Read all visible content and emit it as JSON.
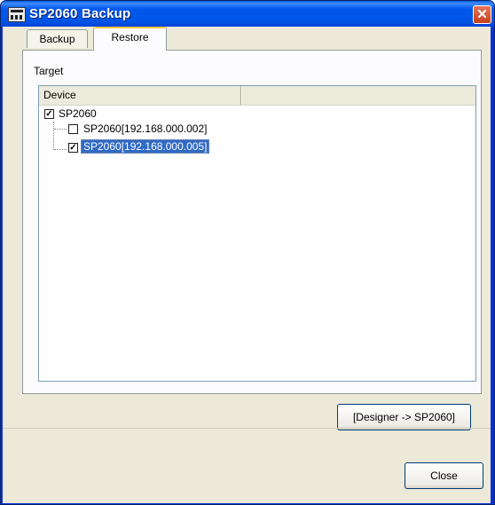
{
  "window": {
    "title": "SP2060 Backup",
    "close_glyph": "✕"
  },
  "tabs": [
    {
      "label": "Backup",
      "active": false
    },
    {
      "label": "Restore",
      "active": true
    }
  ],
  "target_label": "Target",
  "device_list": {
    "columns": [
      "Device",
      ""
    ],
    "items": [
      {
        "label": "SP2060",
        "checked": true,
        "level": 0,
        "selected": false
      },
      {
        "label": "SP2060[192.168.000.002]",
        "checked": false,
        "level": 1,
        "selected": false
      },
      {
        "label": "SP2060[192.168.000.005]",
        "checked": true,
        "level": 1,
        "selected": true
      }
    ]
  },
  "buttons": {
    "designer_to_sp2060": "[Designer -> SP2060]",
    "close": "Close"
  },
  "colors": {
    "titlebar": "#0054e3",
    "selection": "#316ac5",
    "face": "#ece9d8"
  }
}
